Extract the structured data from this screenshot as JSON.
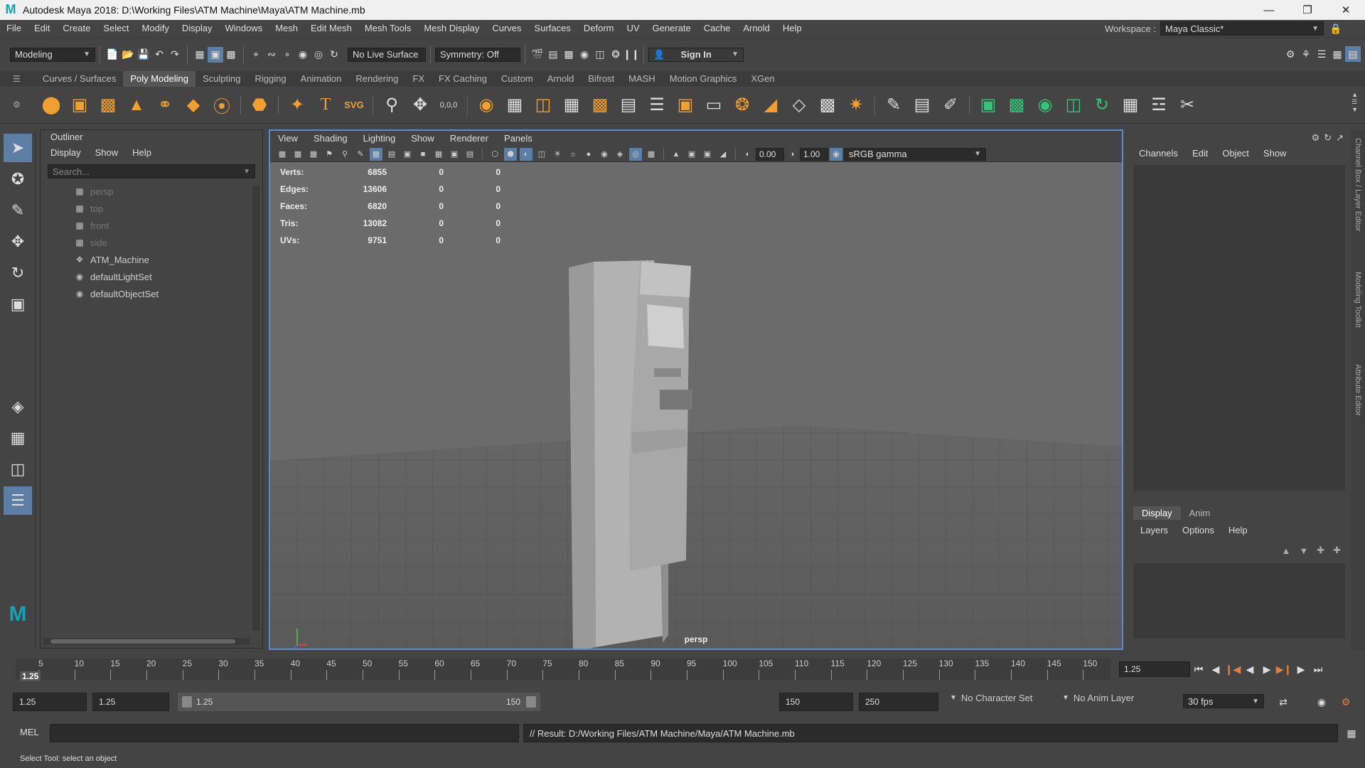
{
  "window": {
    "title": "Autodesk Maya 2018: D:\\Working Files\\ATM Machine\\Maya\\ATM Machine.mb",
    "logo": "M"
  },
  "menubar": {
    "items": [
      "File",
      "Edit",
      "Create",
      "Select",
      "Modify",
      "Display",
      "Windows",
      "Mesh",
      "Edit Mesh",
      "Mesh Tools",
      "Mesh Display",
      "Curves",
      "Surfaces",
      "Deform",
      "UV",
      "Generate",
      "Cache",
      "Arnold",
      "Help"
    ],
    "workspace_label": "Workspace :",
    "workspace_value": "Maya Classic*"
  },
  "statusline": {
    "mode": "Modeling",
    "live_surface": "No Live Surface",
    "symmetry": "Symmetry: Off",
    "sign_in": "Sign In",
    "coords_text": "0,0,0"
  },
  "shelf": {
    "tabs": [
      "Curves / Surfaces",
      "Poly Modeling",
      "Sculpting",
      "Rigging",
      "Animation",
      "Rendering",
      "FX",
      "FX Caching",
      "Custom",
      "Arnold",
      "Bifrost",
      "MASH",
      "Motion Graphics",
      "XGen"
    ],
    "active_tab": "Poly Modeling",
    "icons": [
      "poly-sphere-icon",
      "poly-cube-icon",
      "poly-cylinder-icon",
      "poly-cone-icon",
      "poly-torus-icon",
      "poly-plane-icon",
      "poly-disc-icon",
      "platonic-solid-icon",
      "super-shape-icon",
      "text-icon",
      "svg-icon"
    ],
    "text_glyph": "T",
    "svg_glyph": "SVG"
  },
  "outliner": {
    "title": "Outliner",
    "menu": [
      "Display",
      "Show",
      "Help"
    ],
    "search_placeholder": "Search...",
    "items": [
      {
        "label": "persp",
        "icon": "camera-icon",
        "dim": true
      },
      {
        "label": "top",
        "icon": "camera-icon",
        "dim": true
      },
      {
        "label": "front",
        "icon": "camera-icon",
        "dim": true
      },
      {
        "label": "side",
        "icon": "camera-icon",
        "dim": true
      },
      {
        "label": "ATM_Machine",
        "icon": "transform-icon",
        "dim": false
      },
      {
        "label": "defaultLightSet",
        "icon": "set-icon",
        "dim": false
      },
      {
        "label": "defaultObjectSet",
        "icon": "set-icon",
        "dim": false
      }
    ]
  },
  "viewport": {
    "menu": [
      "View",
      "Shading",
      "Lighting",
      "Show",
      "Renderer",
      "Panels"
    ],
    "exposure": "0.00",
    "gamma": "1.00",
    "color_space": "sRGB gamma",
    "camera": "persp",
    "hud": [
      {
        "label": "Verts:",
        "v1": "6855",
        "v2": "0",
        "v3": "0"
      },
      {
        "label": "Edges:",
        "v1": "13606",
        "v2": "0",
        "v3": "0"
      },
      {
        "label": "Faces:",
        "v1": "6820",
        "v2": "0",
        "v3": "0"
      },
      {
        "label": "Tris:",
        "v1": "13082",
        "v2": "0",
        "v3": "0"
      },
      {
        "label": "UVs:",
        "v1": "9751",
        "v2": "0",
        "v3": "0"
      }
    ]
  },
  "channelbox": {
    "menu": [
      "Channels",
      "Edit",
      "Object",
      "Show"
    ],
    "layer_tabs": [
      "Display",
      "Anim"
    ],
    "layer_menu": [
      "Layers",
      "Options",
      "Help"
    ],
    "side_tabs": [
      "Channel Box / Layer Editor",
      "Modeling Toolkit",
      "Attribute Editor"
    ]
  },
  "timeline": {
    "ticks": [
      "5",
      "10",
      "15",
      "20",
      "25",
      "30",
      "35",
      "40",
      "45",
      "50",
      "55",
      "60",
      "65",
      "70",
      "75",
      "80",
      "85",
      "90",
      "95",
      "100",
      "105",
      "110",
      "115",
      "120",
      "125",
      "130",
      "135",
      "140",
      "145",
      "150"
    ],
    "current_frame": "1.25",
    "current_frame_field": "1.25"
  },
  "range": {
    "start": "1.25",
    "anim_start": "1.25",
    "range_start": "1.25",
    "range_end": "150",
    "anim_end_a": "150",
    "anim_end_b": "250",
    "character_set": "No Character Set",
    "anim_layer": "No Anim Layer",
    "fps": "30 fps"
  },
  "command": {
    "label": "MEL",
    "result": "// Result: D:/Working Files/ATM Machine/Maya/ATM Machine.mb"
  },
  "helpline": "Select Tool: select an object"
}
